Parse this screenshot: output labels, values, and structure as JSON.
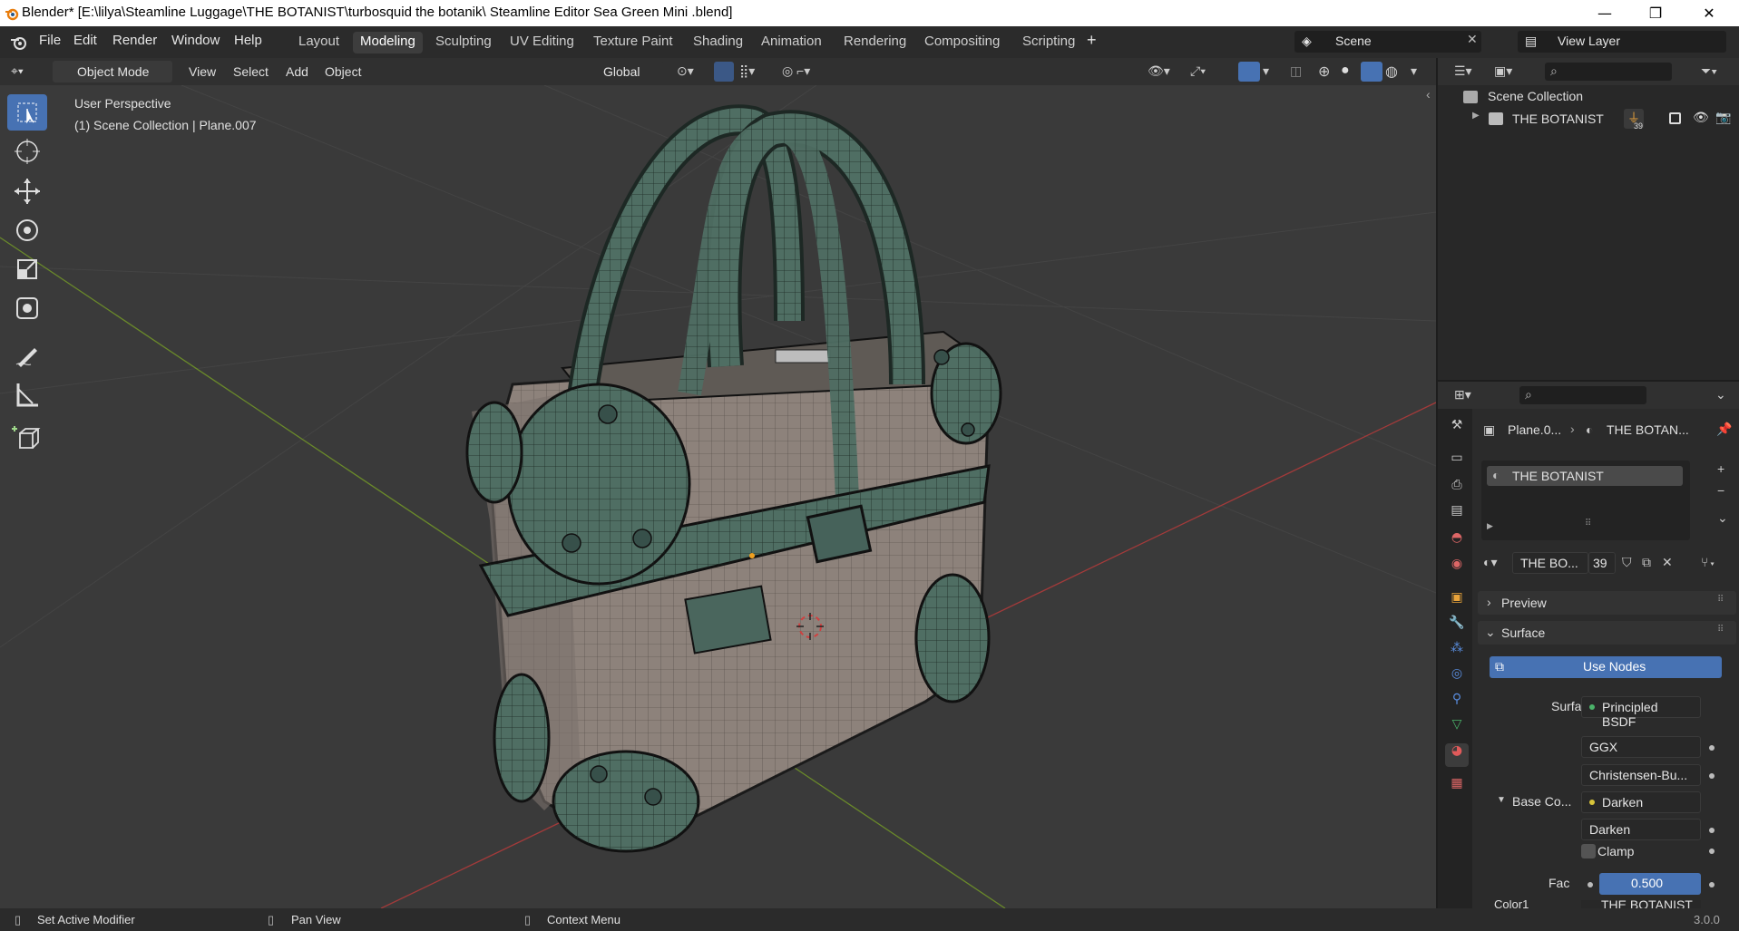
{
  "window": {
    "title": "Blender* [E:\\lilya\\Steamline Luggage\\THE BOTANIST\\turbosquid the botanik\\ Steamline Editor Sea Green Mini .blend]",
    "minimize": "—",
    "restore": "❐",
    "close": "✕"
  },
  "menu": [
    "File",
    "Edit",
    "Render",
    "Window",
    "Help"
  ],
  "workspaces": [
    "Layout",
    "Modeling",
    "Sculpting",
    "UV Editing",
    "Texture Paint",
    "Shading",
    "Animation",
    "Rendering",
    "Compositing",
    "Scripting"
  ],
  "active_workspace": "Modeling",
  "scene_field": "Scene",
  "view_layer_field": "View Layer",
  "viewport_header": {
    "mode": "Object Mode",
    "menus": [
      "View",
      "Select",
      "Add",
      "Object"
    ],
    "orientation": "Global"
  },
  "viewport": {
    "perspective_label": "User Perspective",
    "collection_label": "(1) Scene Collection | Plane.007"
  },
  "outliner": {
    "root": "Scene Collection",
    "items": [
      {
        "label": "THE BOTANIST",
        "badge": "39"
      }
    ]
  },
  "properties": {
    "breadcrumb_object": "Plane.0...",
    "breadcrumb_material": "THE BOTAN...",
    "material_slot": "THE BOTANIST",
    "material_name": "THE BO...",
    "material_users": "39",
    "panels": {
      "preview": "Preview",
      "surface": "Surface"
    },
    "use_nodes": "Use Nodes",
    "surface_label": "Surface",
    "surface_value": "Principled BSDF",
    "distribution": "GGX",
    "subsurface": "Christensen-Bu...",
    "base_color_label": "Base Co...",
    "base_color_value": "Darken",
    "blend_mode": "Darken",
    "clamp_label": "Clamp",
    "fac_label": "Fac",
    "fac_value": "0.500",
    "color1_label": "Color1",
    "color1_value": "THE BOTANIST"
  },
  "status": {
    "left": "Set Active Modifier",
    "middle": "Pan View",
    "right": "Context Menu",
    "version": "3.0.0"
  },
  "colors": {
    "accent": "#4772b3",
    "bag_green": "#4f6e63",
    "bag_body": "#8a7f78",
    "x_axis": "#a33a3a",
    "y_axis": "#6a8a2a"
  }
}
